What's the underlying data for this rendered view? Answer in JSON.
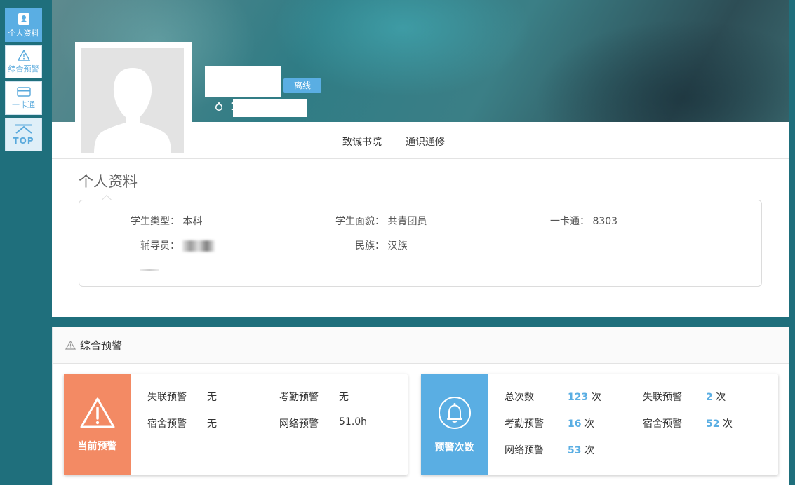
{
  "sidenav": {
    "items": [
      {
        "label": "个人资料",
        "icon": "contact-card-icon"
      },
      {
        "label": "综合预警",
        "icon": "warning-icon"
      },
      {
        "label": "一卡通",
        "icon": "card-icon"
      }
    ],
    "top_label": "TOP"
  },
  "profile": {
    "status": "离线",
    "tabs": [
      "致诚书院",
      "通识通修"
    ],
    "section_title": "个人资料",
    "fields": {
      "student_type": {
        "label": "学生类型：",
        "value": "本科"
      },
      "political": {
        "label": "学生面貌：",
        "value": "共青团员"
      },
      "card": {
        "label": "一卡通：",
        "value": "8303"
      },
      "counselor": {
        "label": "辅导员："
      },
      "ethnicity": {
        "label": "民族：",
        "value": "汉族"
      }
    }
  },
  "warning": {
    "header_title": "综合预警",
    "current": {
      "label": "当前预警",
      "items": [
        {
          "label": "失联预警",
          "value": "无"
        },
        {
          "label": "考勤预警",
          "value": "无"
        },
        {
          "label": "宿舍预警",
          "value": "无"
        },
        {
          "label": "网络预警",
          "value": "51.0h"
        }
      ]
    },
    "counts": {
      "label": "预警次数",
      "unit": "次",
      "items": [
        {
          "label": "总次数",
          "value": "123"
        },
        {
          "label": "失联预警",
          "value": "2"
        },
        {
          "label": "考勤预警",
          "value": "16"
        },
        {
          "label": "宿舍预警",
          "value": "52"
        },
        {
          "label": "网络预警",
          "value": "53"
        }
      ]
    }
  },
  "colors": {
    "background": "#1f6f7c",
    "accent": "#5aaee3",
    "current_warning": "#f38a64",
    "count_warning": "#5aaee3"
  }
}
